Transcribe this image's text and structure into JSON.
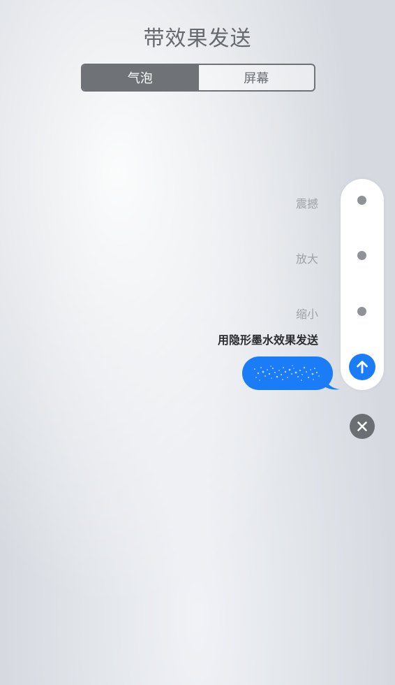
{
  "header": {
    "title": "带效果发送"
  },
  "tabs": [
    {
      "label": "气泡",
      "selected": true
    },
    {
      "label": "屏幕",
      "selected": false
    }
  ],
  "effects": [
    {
      "label": "震撼",
      "selected": false
    },
    {
      "label": "放大",
      "selected": false
    },
    {
      "label": "缩小",
      "selected": false
    },
    {
      "label": "用隐形墨水效果发送",
      "selected": true
    }
  ],
  "icons": {
    "send": "arrow-up-icon",
    "close": "close-icon",
    "effect_marker": "dot-icon"
  },
  "colors": {
    "accent": "#1a7df7",
    "segment_active": "#6f7378",
    "muted_text": "#9ea1a6"
  }
}
